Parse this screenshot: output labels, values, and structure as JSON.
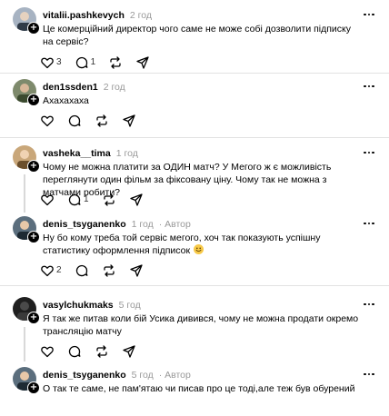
{
  "comments": [
    {
      "username": "vitalii.pashkevych",
      "time": "2 год",
      "author_tag": "",
      "text": "Це комерційний директор чого саме не може собі дозволити підписку на сервіс?",
      "likes": "3",
      "replies": "1",
      "avatar_color": "#a7b3c2"
    },
    {
      "username": "den1ssden1",
      "time": "2 год",
      "author_tag": "",
      "text": "Ахахахаха",
      "likes": "",
      "replies": "",
      "avatar_color": "#7e8a6c"
    },
    {
      "username": "vasheka__tima",
      "time": "1 год",
      "author_tag": "",
      "text": "Чому не можна платити за ОДИН матч? У Мегого ж є можливість переглянути один фільм за фіксовану ціну. Чому так не можна з матчами робити?",
      "likes": "",
      "replies": "1",
      "avatar_color": "#c9a77a"
    },
    {
      "username": "denis_tsyganenko",
      "time": "1 год",
      "author_tag": "Автор",
      "text": "Ну бо кому треба той сервіс мегого, хоч так показують успішну статистику оформлення підписок",
      "has_emoji": true,
      "likes": "2",
      "replies": "",
      "avatar_color": "#5b6e7d"
    },
    {
      "username": "vasylchukmaks",
      "time": "5 год",
      "author_tag": "",
      "text": "Я так же питав коли бій Усика дивився, чому не можна продати окремо трансляцію матчу",
      "likes": "",
      "replies": "",
      "avatar_color": "#1f1f1f"
    },
    {
      "username": "denis_tsyganenko",
      "time": "5 год",
      "author_tag": "Автор",
      "text": "О так те саме, не пам'ятаю чи писав про це тоді,але теж був обурений",
      "likes": "",
      "replies": "",
      "avatar_color": "#5b6e7d"
    }
  ],
  "colors": {
    "text": "#000000",
    "meta": "#999999",
    "divider": "#e2e2e2",
    "thread_line": "#d9d9d9"
  },
  "icons": [
    "heart-icon",
    "comment-icon",
    "repost-icon",
    "share-icon",
    "more-icon",
    "follow-plus-icon"
  ]
}
